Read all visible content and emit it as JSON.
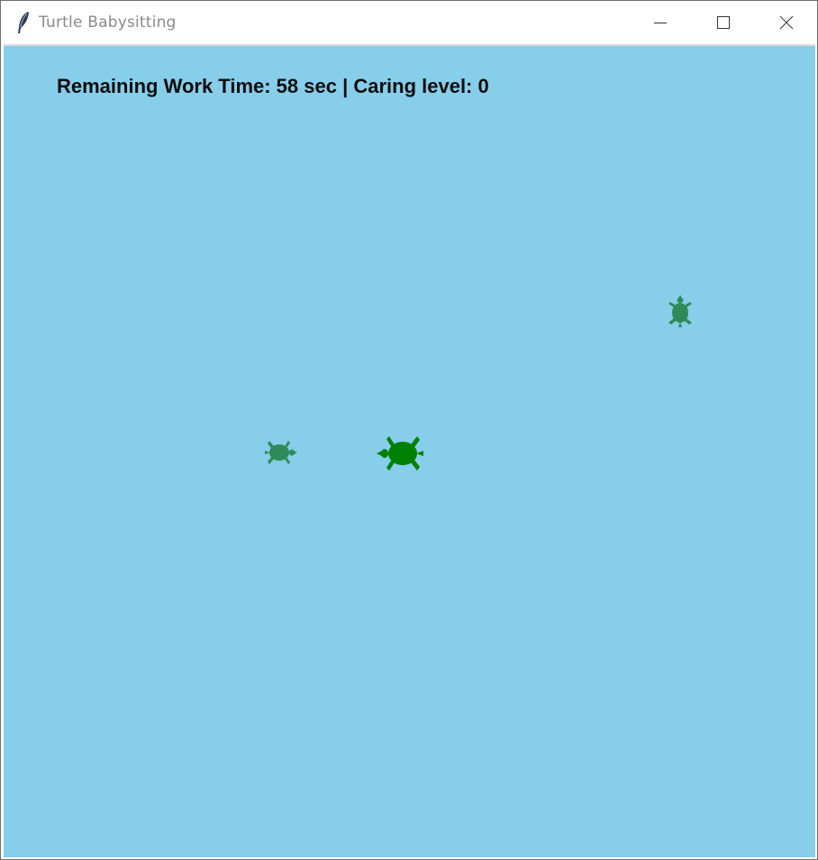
{
  "window": {
    "title": "Turtle Babysitting"
  },
  "icons": {
    "app": "feather-icon",
    "minimize": "minimize-icon",
    "maximize": "maximize-icon",
    "close": "close-icon"
  },
  "colors": {
    "canvas_background": "#87ceeb",
    "player_turtle": "#008000",
    "baby_turtle": "#2e8b57",
    "status_text": "#000000"
  },
  "status": {
    "text": "Remaining Work Time: 58 sec | Caring level: 0"
  },
  "sprites": {
    "player": {
      "name": "player-turtle",
      "color": "#008000"
    },
    "babies": [
      {
        "name": "baby-turtle-1",
        "color": "#2e8b57"
      },
      {
        "name": "baby-turtle-2",
        "color": "#2e8b57"
      }
    ]
  }
}
